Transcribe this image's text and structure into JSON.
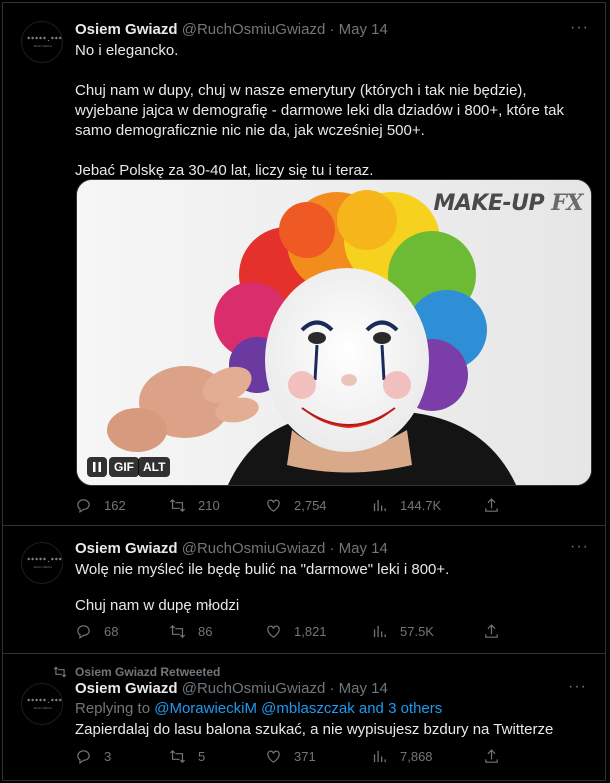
{
  "tweets": [
    {
      "name": "Osiem Gwiazd",
      "handle": "@RuchOsmiuGwiazd",
      "separator": "·",
      "date": "May 14",
      "paragraphs": [
        "No i elegancko.",
        "Chuj nam w dupy, chuj w nasze emerytury (których i tak nie będzie), wyjebane jajca w demografię - darmowe leki dla dziadów i 800+, które tak samo demograficznie nic nie da, jak wcześniej 500+.",
        "Jebać Polskę za 30-40 lat, liczy się tu i teraz."
      ],
      "media": {
        "watermark_main": "MAKE-UP",
        "watermark_fx": "FX",
        "gif_label": "GIF",
        "alt_label": "ALT"
      },
      "stats": {
        "replies": "162",
        "retweets": "210",
        "likes": "2,754",
        "views": "144.7K"
      }
    },
    {
      "name": "Osiem Gwiazd",
      "handle": "@RuchOsmiuGwiazd",
      "separator": "·",
      "date": "May 14",
      "paragraphs": [
        "Wolę nie myśleć ile będę bulić na \"darmowe\" leki i 800+.",
        "Chuj nam w dupę młodzi"
      ],
      "stats": {
        "replies": "68",
        "retweets": "86",
        "likes": "1,821",
        "views": "57.5K"
      }
    },
    {
      "retweeted_by": "Osiem Gwiazd Retweeted",
      "name": "Osiem Gwiazd",
      "handle": "@RuchOsmiuGwiazd",
      "separator": "·",
      "date": "May 14",
      "replying_to_prefix": "Replying to",
      "replying_to_mentions": "@MorawieckiM @mblaszczak and 3 others",
      "paragraphs": [
        "Zapierdalaj do lasu balona szukać, a nie wypisujesz bzdury na Twitterze"
      ],
      "stats": {
        "replies": "3",
        "retweets": "5",
        "likes": "371",
        "views": "7,868"
      }
    }
  ],
  "avatar_text": "*****.***",
  "avatar_subtext": "Ruch Ośmiu",
  "more_glyph": "···",
  "colors": {
    "background": "#000000",
    "text": "#e7e9ea",
    "muted": "#71767b",
    "mention": "#1d9bf0",
    "border": "#2f3336"
  },
  "icons": [
    "reply-icon",
    "retweet-icon",
    "like-icon",
    "views-icon",
    "share-icon",
    "more-icon",
    "pause-icon"
  ]
}
